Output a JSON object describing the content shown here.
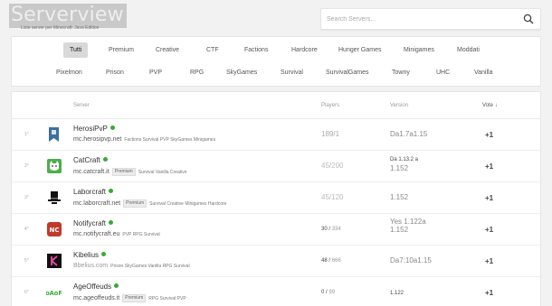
{
  "header": {
    "logo": "Serverview",
    "subtitle": "Liste server per Minecraft: Java Edition",
    "search_placeholder": "Search Servers...",
    "search_icon": "search-icon"
  },
  "categories": {
    "row1": [
      "Tutti",
      "Premium",
      "Creative",
      "CTF",
      "Factions",
      "Hardcore",
      "Hunger Games",
      "Minigames",
      "Moddati"
    ],
    "row2": [
      "Pixelmon",
      "Prison",
      "PVP",
      "RPG",
      "SkyGames",
      "Survival",
      "SurvivalGames",
      "Towny",
      "UHC",
      "Vanilla"
    ],
    "active": "Tutti"
  },
  "table": {
    "headers": {
      "server": "Server",
      "players": "Players",
      "version": "Version",
      "vote": "Vote"
    },
    "rows": [
      {
        "rank": "1°",
        "name": "HerosiPvP",
        "address": "mc.herosipvp.net",
        "premium": "",
        "tags": "Factions Survival PVP SkyGames Minigames",
        "players": "189/1",
        "players_total": "",
        "version": "Da1.7a1.15",
        "version2": "",
        "votes": "+1",
        "icon": "banner-icon"
      },
      {
        "rank": "2°",
        "name": "CatCraft",
        "address": "mc.catcraft.it",
        "premium": "Premium",
        "tags": "Survival Vanilla Creative",
        "players": "45/200",
        "players_total": "",
        "version": "Da 1.13.2 a",
        "version2": "1.152",
        "votes": "+1",
        "icon": "cat-icon"
      },
      {
        "rank": "3°",
        "name": "Laborcraft",
        "address": "mc.laborcraft.net",
        "premium": "Premium",
        "tags": "Survival Creative Minigames Hardcore",
        "players": "45/120",
        "players_total": "",
        "version": "1.152",
        "version2": "",
        "votes": "+1",
        "icon": "top-hat-icon"
      },
      {
        "rank": "4°",
        "name": "Notifycraft",
        "address": "mc.notifycraft.eu",
        "premium": "",
        "tags": "PVP RPG Survival",
        "players": "30",
        "players_total": "334",
        "version": "Yes 1.122a",
        "version2": "1.152",
        "votes": "+1",
        "icon": "nc-logo-icon"
      },
      {
        "rank": "5°",
        "name": "Kibelius",
        "address": "Bbelius.com",
        "premium": "",
        "tags": "Prison SkyGames Vanilla RPG Survival",
        "players": "48",
        "players_total": "666",
        "version": "Da7:10a1.15",
        "version2": "",
        "votes": "+1",
        "icon": "kibelius-logo-icon"
      },
      {
        "rank": "6°",
        "name": "AgeOffeuds",
        "address": "mc.ageoffeuds.it",
        "premium": "Premium",
        "tags": "RPG Survival PVP",
        "players": "0",
        "players_total": "99",
        "version": "1.122",
        "version2": "",
        "votes": "+1",
        "icon": "aof-logo-icon"
      }
    ]
  },
  "colors": {
    "online": "#3aaa35",
    "active_chip": "#d9d9d9",
    "background": "#f2f2f2"
  }
}
